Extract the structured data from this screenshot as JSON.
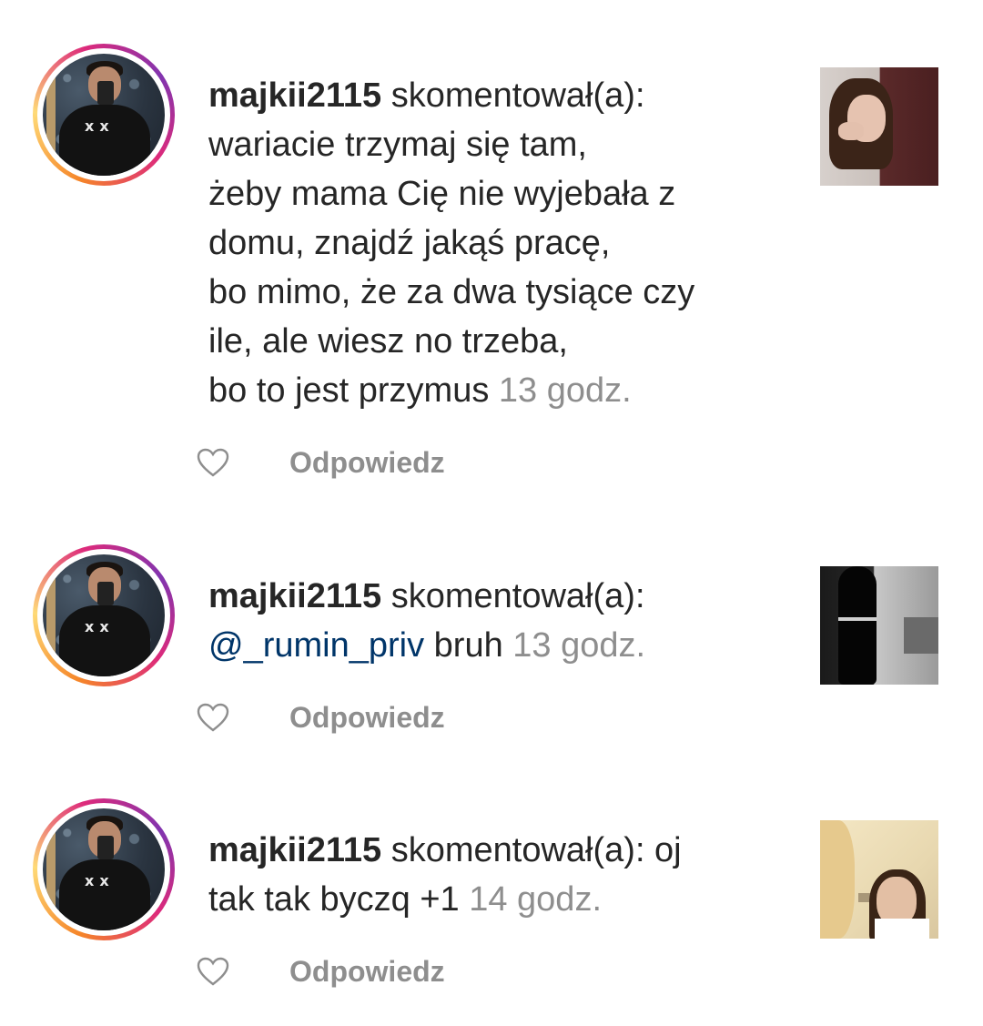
{
  "comments": [
    {
      "username": "majkii2115",
      "action": " skomentował(a):",
      "lines": "wariacie trzymaj się tam,\nżeby mama Cię nie wyjebała z\ndomu, znajdź jakąś pracę,\nbo mimo, że za dwa tysiące czy\nile, ale wiesz no trzeba,\nbo to jest przymus",
      "time": " 13 godz.",
      "reply_label": "Odpowiedz"
    },
    {
      "username": "majkii2115",
      "action": " skomentował(a):",
      "mention": "@_rumin_priv",
      "lines": " bruh",
      "time": " 13 godz.",
      "reply_label": "Odpowiedz"
    },
    {
      "username": "majkii2115",
      "action": " skomentował(a): oj",
      "lines": "tak tak byczq +1",
      "time": " 14 godz.",
      "reply_label": "Odpowiedz"
    }
  ],
  "icons": {
    "like": "heart-outline-icon"
  },
  "colors": {
    "text": "#262626",
    "secondary": "#8e8e8e",
    "mention": "#003569"
  }
}
